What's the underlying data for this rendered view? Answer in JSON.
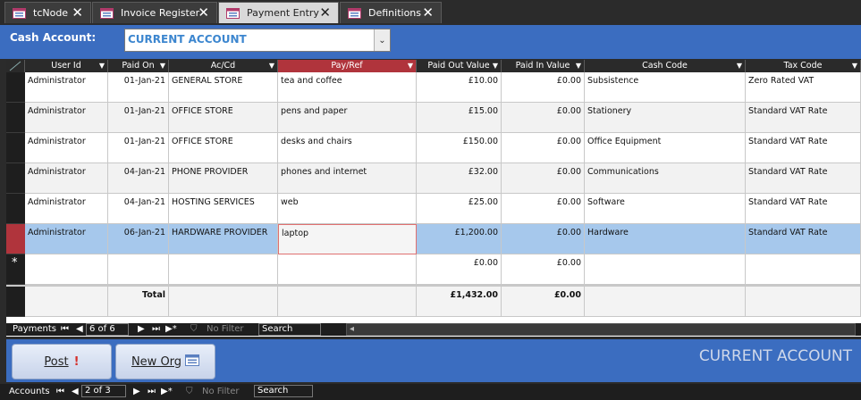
{
  "tabs": [
    {
      "label": "tcNode",
      "active": false
    },
    {
      "label": "Invoice Register",
      "active": false
    },
    {
      "label": "Payment Entry",
      "active": true
    },
    {
      "label": "Definitions",
      "active": false
    }
  ],
  "header": {
    "cash_account_label": "Cash Account:",
    "cash_account_value": "CURRENT ACCOUNT"
  },
  "grid": {
    "columns": [
      "User Id",
      "Paid On",
      "Ac/Cd",
      "Pay/Ref",
      "Paid Out Value",
      "Paid In Value",
      "Cash Code",
      "Tax Code"
    ],
    "rows": [
      {
        "user": "Administrator",
        "paid_on": "01-Jan-21",
        "accd": "GENERAL STORE",
        "payref": "tea and coffee",
        "out": "£10.00",
        "in": "£0.00",
        "cash": "Subsistence",
        "tax": "Zero Rated VAT"
      },
      {
        "user": "Administrator",
        "paid_on": "01-Jan-21",
        "accd": "OFFICE STORE",
        "payref": "pens and paper",
        "out": "£15.00",
        "in": "£0.00",
        "cash": "Stationery",
        "tax": "Standard VAT Rate"
      },
      {
        "user": "Administrator",
        "paid_on": "01-Jan-21",
        "accd": "OFFICE STORE",
        "payref": "desks and chairs",
        "out": "£150.00",
        "in": "£0.00",
        "cash": "Office Equipment",
        "tax": "Standard VAT Rate"
      },
      {
        "user": "Administrator",
        "paid_on": "04-Jan-21",
        "accd": "PHONE PROVIDER",
        "payref": "phones and internet",
        "out": "£32.00",
        "in": "£0.00",
        "cash": "Communications",
        "tax": "Standard VAT Rate"
      },
      {
        "user": "Administrator",
        "paid_on": "04-Jan-21",
        "accd": "HOSTING SERVICES",
        "payref": "web",
        "out": "£25.00",
        "in": "£0.00",
        "cash": "Software",
        "tax": "Standard VAT Rate"
      },
      {
        "user": "Administrator",
        "paid_on": "06-Jan-21",
        "accd": "HARDWARE PROVIDER",
        "payref": "laptop",
        "out": "£1,200.00",
        "in": "£0.00",
        "cash": "Hardware",
        "tax": "Standard VAT Rate"
      }
    ],
    "new_row": {
      "marker": "*",
      "out": "£0.00",
      "in": "£0.00"
    },
    "total": {
      "label": "Total",
      "out": "£1,432.00",
      "in": "£0.00"
    }
  },
  "payments_nav": {
    "label": "Payments",
    "record": "6 of 6",
    "filter": "No Filter",
    "search": "Search"
  },
  "footer": {
    "post_label": "Post",
    "neworg_label": "New Org",
    "account_caption": "CURRENT ACCOUNT"
  },
  "accounts_nav": {
    "label": "Accounts",
    "record": "2 of 3",
    "filter": "No Filter",
    "search": "Search"
  }
}
